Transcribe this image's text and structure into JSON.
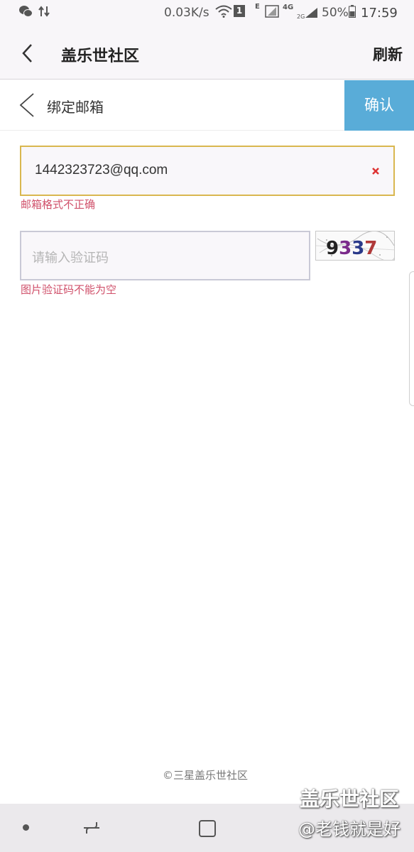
{
  "status_bar": {
    "net_speed": "0.03K/s",
    "sim_slot": "1",
    "network_e": "E",
    "network_4g": "4G",
    "battery_percent": "50%",
    "time": "17:59"
  },
  "app_bar": {
    "title": "盖乐世社区",
    "refresh_label": "刷新"
  },
  "page_header": {
    "title": "绑定邮箱",
    "confirm_label": "确认",
    "confirm_color": "#59acd8"
  },
  "form": {
    "email_value": "1442323723@qq.com",
    "email_error": "邮箱格式不正确",
    "captcha_placeholder": "请输入验证码",
    "captcha_image_text": "9337",
    "captcha_error": "图片验证码不能为空",
    "error_color": "#d0516b"
  },
  "footer": {
    "copyright": "©三星盖乐世社区"
  },
  "watermark": {
    "line1": "盖乐世社区",
    "line2": "@老钱就是好"
  }
}
